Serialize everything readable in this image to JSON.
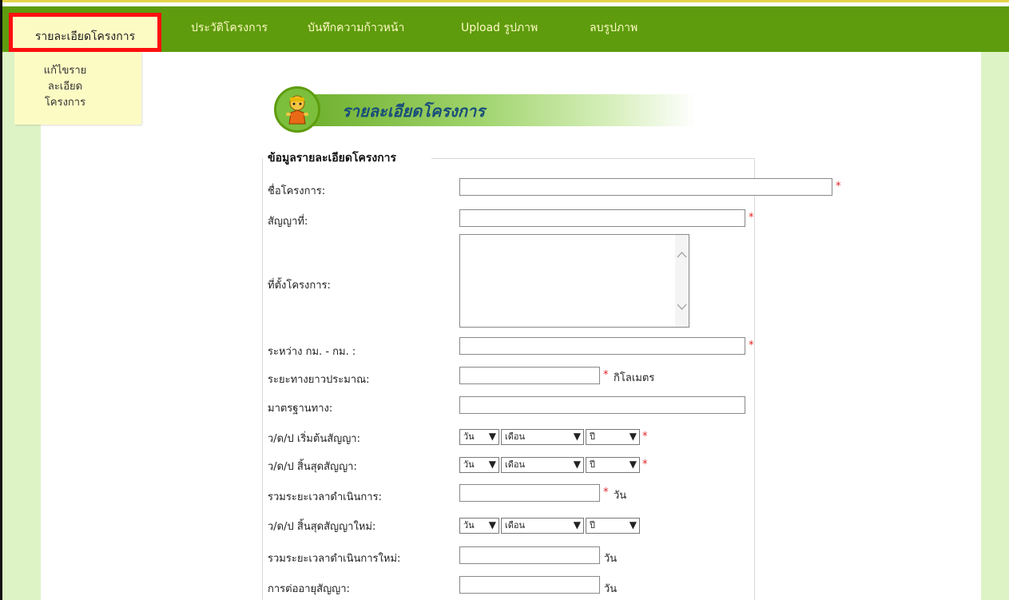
{
  "nav": {
    "active": "รายละเอียดโครงการ",
    "items": [
      "ประวัติโครงการ",
      "บันทึกความก้าวหน้า",
      "Upload รูปภาพ",
      "ลบรูปภาพ"
    ]
  },
  "submenu": {
    "item": "แก้ไขรายละเอียดโครงการ"
  },
  "banner": {
    "title": "รายละเอียดโครงการ"
  },
  "form": {
    "legend": "ข้อมูลรายละเอียดโครงการ",
    "project_name_label": "ชื่อโครงการ:",
    "contract_no_label": "สัญญาที่:",
    "location_label": "ที่ตั้งโครงการ:",
    "km_range_label": "ระหว่าง กม. - กม. :",
    "length_label": "ระยะทางยาวประมาณ:",
    "length_unit": "กิโลเมตร",
    "road_std_label": "มาตรฐานทาง:",
    "start_date_label": "ว/ด/ป เริ่มต้นสัญญา:",
    "end_date_label": "ว/ด/ป สิ้นสุดสัญญา:",
    "duration_label": "รวมระยะเวลาดำเนินการ:",
    "new_end_date_label": "ว/ด/ป สิ้นสุดสัญญาใหม่:",
    "new_duration_label": "รวมระยะเวลาดำเนินการใหม่:",
    "extension_label": "การต่ออายุสัญญา:",
    "day_unit": "วัน",
    "required_mark": "*",
    "day_select": "วัน",
    "month_select": "เดือน",
    "year_select": "ปี"
  },
  "colors": {
    "nav_bg": "#5e9c0e",
    "nav_text": "#fff9c2",
    "active_bg": "#fdfbc4",
    "highlight": "#ff1010",
    "gutter": "#ddf3c6",
    "required": "#e02020"
  },
  "icons": [
    "mascot-icon",
    "chevron-down-icon",
    "scroll-up-icon",
    "scroll-down-icon"
  ]
}
